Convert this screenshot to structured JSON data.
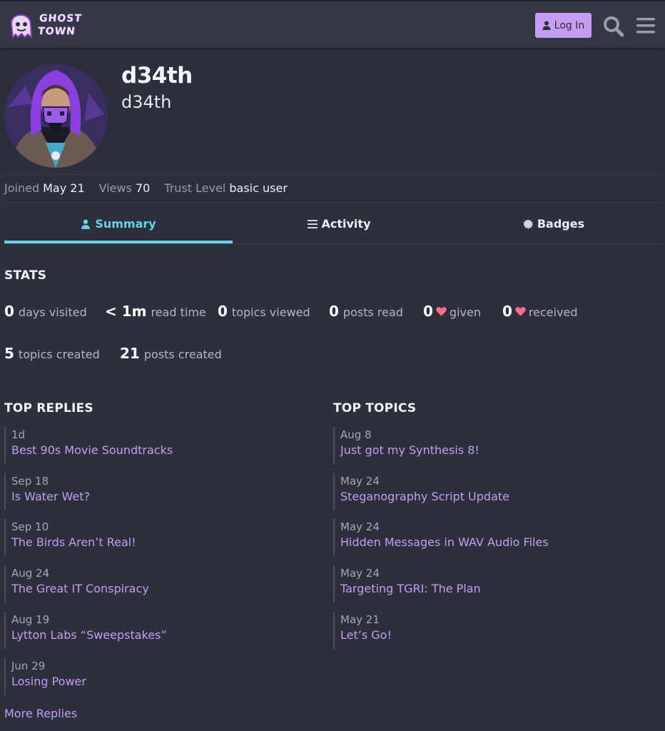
{
  "header": {
    "logo_line1": "GHOST",
    "logo_line2": "TOWN",
    "login_label": "Log In"
  },
  "profile": {
    "username": "d34th",
    "name": "d34th",
    "joined_label": "Joined",
    "joined_value": "May 21",
    "views_label": "Views",
    "views_value": "70",
    "trust_label": "Trust Level",
    "trust_value": "basic user"
  },
  "tabs": [
    {
      "label": "Summary",
      "icon": "user-icon"
    },
    {
      "label": "Activity",
      "icon": "list-icon"
    },
    {
      "label": "Badges",
      "icon": "certificate-icon"
    }
  ],
  "stats": {
    "title": "STATS",
    "items": [
      {
        "num": "0",
        "label": "days visited"
      },
      {
        "num": "< 1m",
        "label": "read time"
      },
      {
        "num": "0",
        "label": "topics viewed"
      },
      {
        "num": "0",
        "label": "posts read"
      },
      {
        "num": "0",
        "label": "given"
      },
      {
        "num": "0",
        "label": "received"
      },
      {
        "num": "5",
        "label": "topics created"
      },
      {
        "num": "21",
        "label": "posts created"
      }
    ]
  },
  "top_replies": {
    "title": "TOP REPLIES",
    "items": [
      {
        "date": "1d",
        "title": "Best 90s Movie Soundtracks"
      },
      {
        "date": "Sep 18",
        "title": "Is Water Wet?"
      },
      {
        "date": "Sep 10",
        "title": "The Birds Aren’t Real!"
      },
      {
        "date": "Aug 24",
        "title": "The Great IT Conspiracy"
      },
      {
        "date": "Aug 19",
        "title": "Lytton Labs “Sweepstakes”"
      },
      {
        "date": "Jun 29",
        "title": "Losing Power"
      }
    ],
    "more_label": "More Replies"
  },
  "top_topics": {
    "title": "TOP TOPICS",
    "items": [
      {
        "date": "Aug 8",
        "title": "Just got my Synthesis 8!"
      },
      {
        "date": "May 24",
        "title": "Steganography Script Update"
      },
      {
        "date": "May 24",
        "title": "Hidden Messages in WAV Audio Files"
      },
      {
        "date": "May 24",
        "title": "Targeting TGRI: The Plan"
      },
      {
        "date": "May 21",
        "title": "Let’s Go!"
      }
    ]
  },
  "colors": {
    "background": "#2c2f3c",
    "header": "#343744",
    "accent_purple": "#c69cf3",
    "accent_cyan": "#6ad0ea",
    "heart": "#fa6c8d"
  }
}
